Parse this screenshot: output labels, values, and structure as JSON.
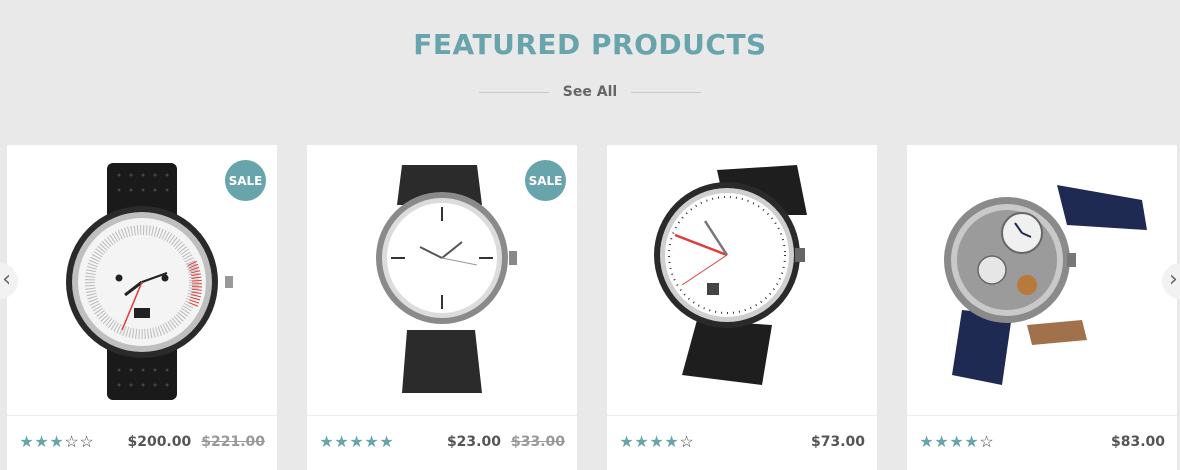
{
  "section": {
    "title": "FEATURED PRODUCTS",
    "see_all": "See All"
  },
  "carousel": {
    "prev_icon": "chevron-left-icon",
    "next_icon": "chevron-right-icon"
  },
  "colors": {
    "accent": "#67a4ab",
    "background": "#e9e9e9"
  },
  "products": [
    {
      "image": "watch-white-dial-black-leather-strap",
      "badge": "SALE",
      "rating": 3,
      "rating_max": 5,
      "price": "$200.00",
      "old_price": "$221.00"
    },
    {
      "image": "watch-minimal-white-dial-leather-strap",
      "badge": "SALE",
      "rating": 5,
      "rating_max": 5,
      "price": "$23.00",
      "old_price": "$33.00"
    },
    {
      "image": "watch-white-dial-black-strap",
      "badge": "",
      "rating": 4,
      "rating_max": 5,
      "price": "$73.00",
      "old_price": ""
    },
    {
      "image": "watch-skeleton-navy-strap",
      "badge": "",
      "rating": 4,
      "rating_max": 5,
      "price": "$83.00",
      "old_price": ""
    }
  ]
}
